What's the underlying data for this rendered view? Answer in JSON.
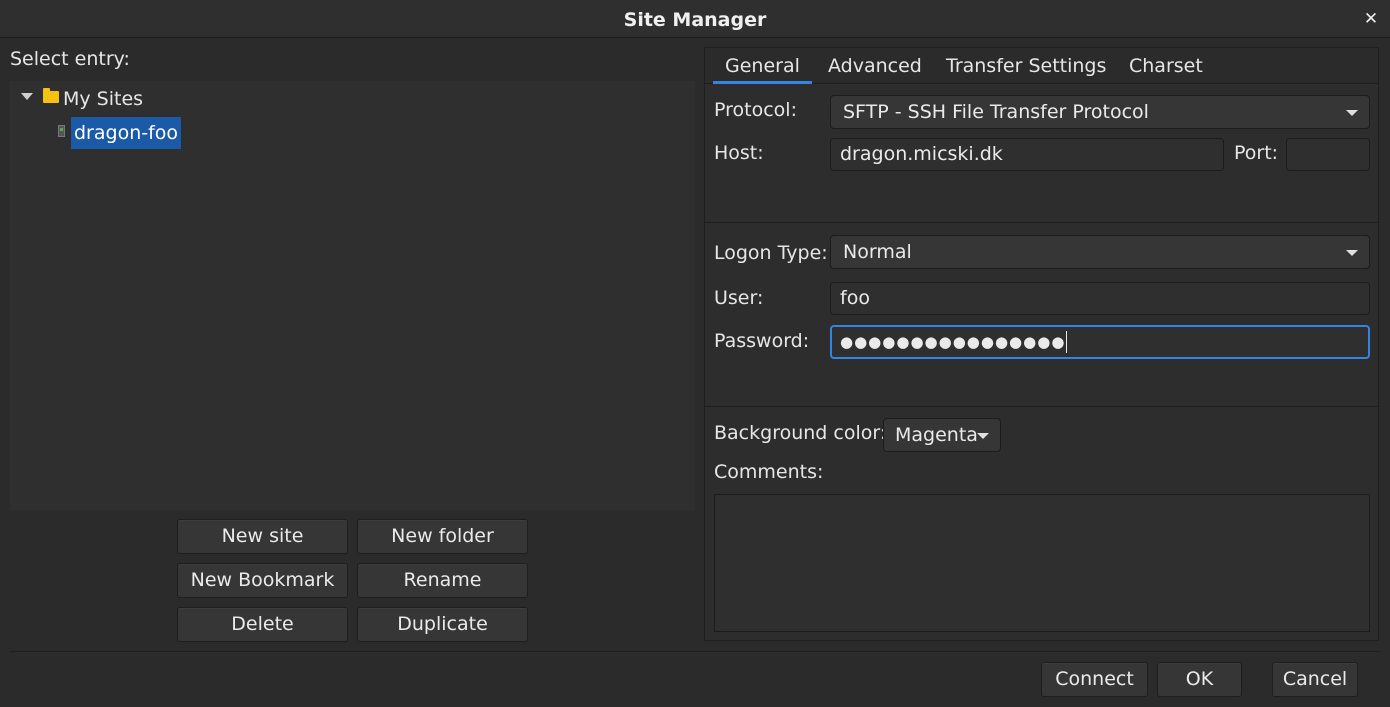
{
  "window": {
    "title": "Site Manager",
    "close_glyph": "✕"
  },
  "left": {
    "select_label": "Select entry:",
    "tree": {
      "root_label": "My Sites",
      "site_label": "dragon-foo"
    },
    "buttons": {
      "new_site": "New site",
      "new_folder": "New folder",
      "new_bookmark": "New Bookmark",
      "rename": "Rename",
      "delete": "Delete",
      "duplicate": "Duplicate"
    }
  },
  "tabs": [
    "General",
    "Advanced",
    "Transfer Settings",
    "Charset"
  ],
  "general": {
    "protocol_label": "Protocol:",
    "protocol_value": "SFTP - SSH File Transfer Protocol",
    "host_label": "Host:",
    "host_value": "dragon.micski.dk",
    "port_label": "Port:",
    "port_value": "",
    "logon_type_label": "Logon Type:",
    "logon_type_value": "Normal",
    "user_label": "User:",
    "user_value": "foo",
    "password_label": "Password:",
    "password_value": "●●●●●●●●●●●●●●●●",
    "bg_color_label": "Background color:",
    "bg_color_value": "Magenta",
    "comments_label": "Comments:"
  },
  "footer": {
    "connect": "Connect",
    "ok": "OK",
    "cancel": "Cancel"
  },
  "colors": {
    "accent": "#3584e4",
    "selection": "#1b5aa6",
    "folder": "#f5c211"
  }
}
